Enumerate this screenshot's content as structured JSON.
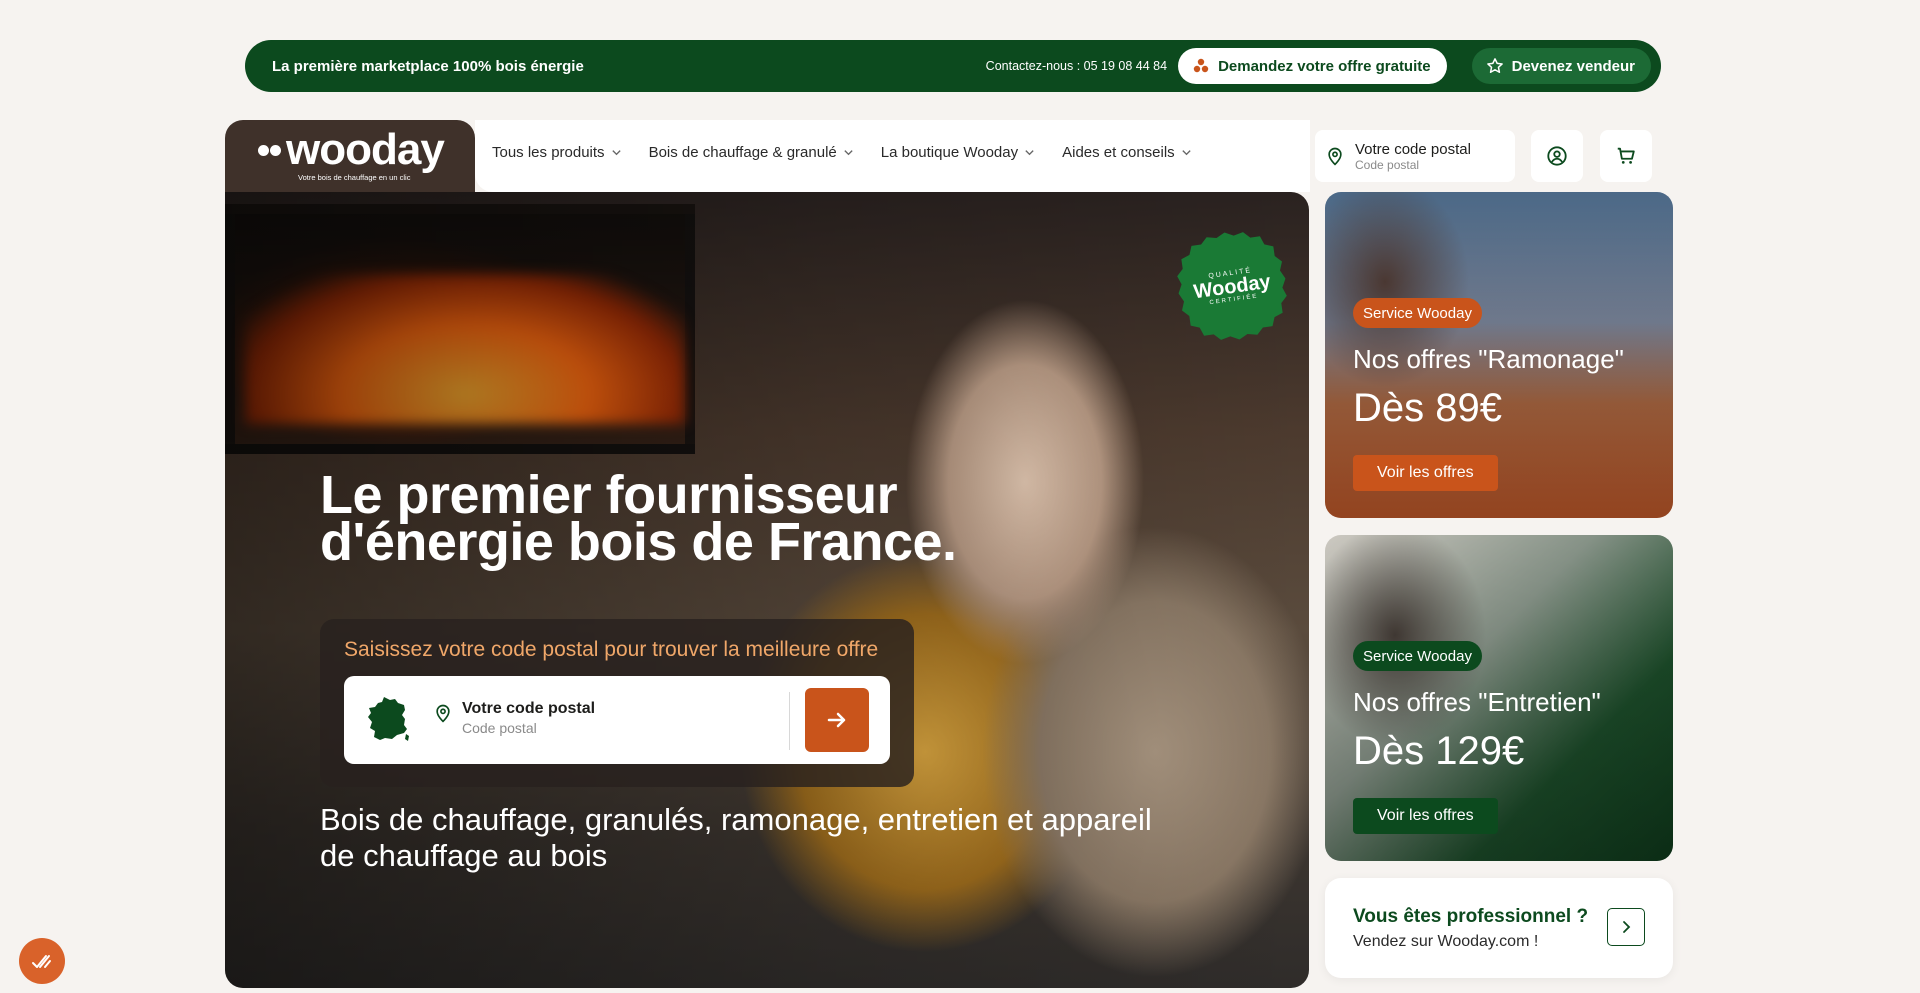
{
  "topbar": {
    "tagline": "La première marketplace 100% bois énergie",
    "contact": "Contactez-nous : 05 19 08 44 84",
    "offer_button": "Demandez votre offre gratuite",
    "seller_button": "Devenez vendeur"
  },
  "header": {
    "logo_text": "wooday",
    "logo_slogan": "Votre bois de chauffage en un clic",
    "nav": [
      {
        "label": "Tous les produits"
      },
      {
        "label": "Bois de chauffage & granulé"
      },
      {
        "label": "La boutique Wooday"
      },
      {
        "label": "Aides et conseils"
      }
    ],
    "postal": {
      "title": "Votre code postal",
      "placeholder": "Code postal"
    }
  },
  "hero": {
    "seal": {
      "top": "QUALITÉ",
      "brand": "Wooday",
      "bottom": "CERTIFIÉE"
    },
    "title_line1": "Le premier fournisseur",
    "title_line2": "d'énergie bois de France.",
    "search_label": "Saisissez votre code postal pour trouver la meilleure offre",
    "search_title": "Votre code postal",
    "search_placeholder": "Code postal",
    "subtitle": "Bois de chauffage, granulés, ramonage, entretien et appareil de chauffage au bois"
  },
  "cards": [
    {
      "tag": "Service Wooday",
      "title": "Nos offres \"Ramonage\"",
      "price": "Dès 89€",
      "cta": "Voir les offres"
    },
    {
      "tag": "Service Wooday",
      "title": "Nos offres \"Entretien\"",
      "price": "Dès 129€",
      "cta": "Voir les offres"
    }
  ],
  "pro": {
    "question": "Vous êtes professionnel ?",
    "text": "Vendez sur Wooday.com !"
  },
  "colors": {
    "brand_green": "#0c4a1e",
    "brand_orange": "#c9541b",
    "background": "#f6f3f0"
  }
}
